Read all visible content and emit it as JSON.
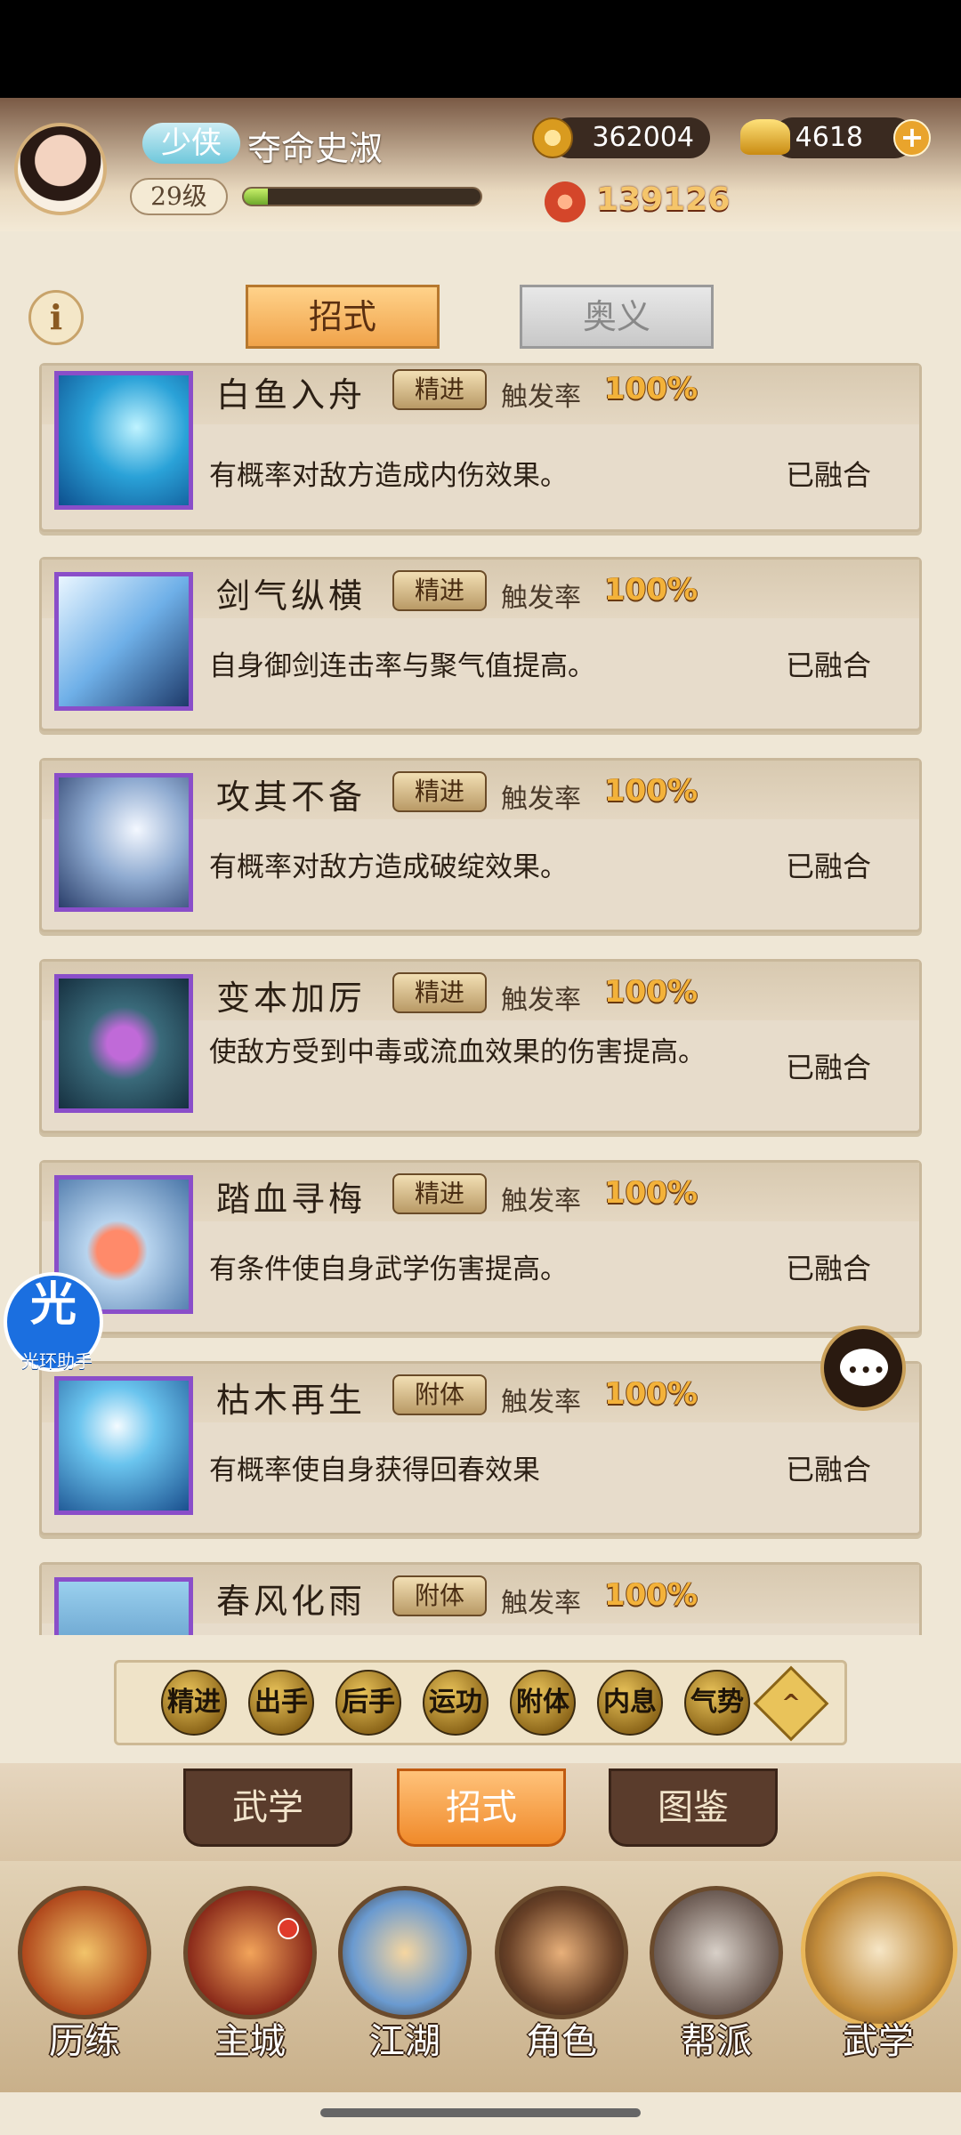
{
  "header": {
    "rank_tag": "少侠",
    "player_name": "夺命史淑",
    "level": "29级",
    "exp_fraction": 0.1,
    "coins": "362004",
    "ingots": "4618",
    "power": "139126"
  },
  "tabs": {
    "active": "招式",
    "inactive": "奥义"
  },
  "skills": [
    {
      "name": "白鱼入舟",
      "tag": "精进",
      "rate_label": "触发率",
      "rate": "100%",
      "desc": "有概率对敌方造成内伤效果。",
      "status": "已融合"
    },
    {
      "name": "剑气纵横",
      "tag": "精进",
      "rate_label": "触发率",
      "rate": "100%",
      "desc": "自身御剑连击率与聚气值提高。",
      "status": "已融合"
    },
    {
      "name": "攻其不备",
      "tag": "精进",
      "rate_label": "触发率",
      "rate": "100%",
      "desc": "有概率对敌方造成破绽效果。",
      "status": "已融合"
    },
    {
      "name": "变本加厉",
      "tag": "精进",
      "rate_label": "触发率",
      "rate": "100%",
      "desc": "使敌方受到中毒或流血效果的伤害提高。",
      "status": "已融合"
    },
    {
      "name": "踏血寻梅",
      "tag": "精进",
      "rate_label": "触发率",
      "rate": "100%",
      "desc": "有条件使自身武学伤害提高。",
      "status": "已融合"
    },
    {
      "name": "枯木再生",
      "tag": "附体",
      "rate_label": "触发率",
      "rate": "100%",
      "desc": "有概率使自身获得回春效果",
      "status": "已融合"
    },
    {
      "name": "春风化雨",
      "tag": "附体",
      "rate_label": "触发率",
      "rate": "100%",
      "desc": "",
      "status": ""
    }
  ],
  "filters": [
    "精进",
    "出手",
    "后手",
    "运功",
    "附体",
    "内息",
    "气势"
  ],
  "sub_tabs": [
    "武学",
    "招式",
    "图鉴"
  ],
  "nav": [
    "历练",
    "主城",
    "江湖",
    "角色",
    "帮派",
    "武学"
  ],
  "floating": {
    "helper_glyph": "光",
    "helper_label": "光环助手"
  },
  "colors": {
    "accent": "#f0a34a",
    "card_border": "#8a4ec9",
    "rate_gold": "#f3b23a"
  }
}
